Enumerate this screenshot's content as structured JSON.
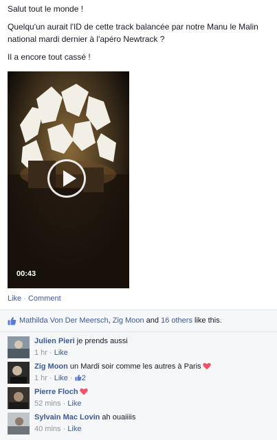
{
  "post": {
    "greeting": "Salut tout le monde !",
    "message": "Quelqu'un aurait l'ID de cette track balancée par notre Manu le Malin national mardi dernier à l'apéro Newtrack ?",
    "followup": "Il a encore tout cassé !",
    "video": {
      "duration": "00:43"
    },
    "actions": {
      "like": "Like",
      "separator": " · ",
      "comment": "Comment"
    }
  },
  "likes": {
    "name1": "Mathilda Von Der Meersch",
    "sep1": ", ",
    "name2": "Zig Moon",
    "and": " and ",
    "others": "16 others",
    "suffix": " like this."
  },
  "comments": [
    {
      "author": "Julien Pieri",
      "text": " je prends aussi",
      "time": "1 hr",
      "like": "Like",
      "heart": false
    },
    {
      "author": "Zig Moon",
      "text": " un Mardi soir comme les autres à Paris",
      "time": "1 hr",
      "like": "Like",
      "heart": true,
      "like_count": "2"
    },
    {
      "author": "Pierre Floch",
      "text": "",
      "time": "52 mins",
      "like": "Like",
      "heart": true
    },
    {
      "author": "Sylvain Mac Lovin",
      "text": " ah ouaiiiis",
      "time": "40 mins",
      "like": "Like",
      "heart": false
    }
  ],
  "colors": {
    "link": "#3b5998",
    "meta": "#90949c",
    "ufi_bg": "#f6f7f8",
    "heart": "#f25268"
  },
  "icons": {
    "play": "play-icon",
    "thumb": "thumbs-up-icon",
    "heart": "heart-icon"
  }
}
